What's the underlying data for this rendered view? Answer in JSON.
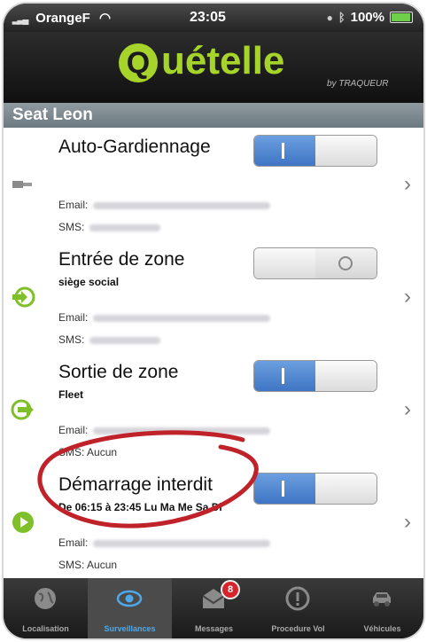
{
  "status_bar": {
    "carrier": "OrangeF",
    "time": "23:05",
    "battery": "100%"
  },
  "header": {
    "logo_text": "uételle",
    "logo_sub": "by TRAQUEUR"
  },
  "section": {
    "title": "Seat Leon"
  },
  "rows": [
    {
      "title": "Auto-Gardiennage",
      "subtitle": "",
      "email_label": "Email:",
      "sms_label": "SMS:",
      "sms_value": "",
      "toggle_on": true,
      "icon": "plug-icon"
    },
    {
      "title": "Entrée de zone",
      "subtitle": "siège social",
      "email_label": "Email:",
      "sms_label": "SMS:",
      "sms_value": "",
      "toggle_on": false,
      "icon": "zone-enter-icon"
    },
    {
      "title": "Sortie de zone",
      "subtitle": "Fleet",
      "email_label": "Email:",
      "sms_label": "SMS:",
      "sms_value": "Aucun",
      "toggle_on": true,
      "icon": "zone-exit-icon"
    },
    {
      "title": "Démarrage interdit",
      "subtitle": "De 06:15 à 23:45     Lu Ma Me Sa Di",
      "email_label": "Email:",
      "sms_label": "SMS:",
      "sms_value": "Aucun",
      "toggle_on": true,
      "icon": "start-block-icon"
    }
  ],
  "tabs": [
    {
      "label": "Localisation",
      "icon": "globe-icon"
    },
    {
      "label": "Surveillances",
      "icon": "eye-icon"
    },
    {
      "label": "Messages",
      "icon": "envelope-icon",
      "badge": "8"
    },
    {
      "label": "Procedure Vol",
      "icon": "alert-icon"
    },
    {
      "label": "Véhicules",
      "icon": "car-icon"
    }
  ],
  "colors": {
    "accent": "#a6d42a",
    "toggle_on": "#3f75c4",
    "tab_active": "#4fa8e8",
    "annotation": "#c0222a"
  }
}
